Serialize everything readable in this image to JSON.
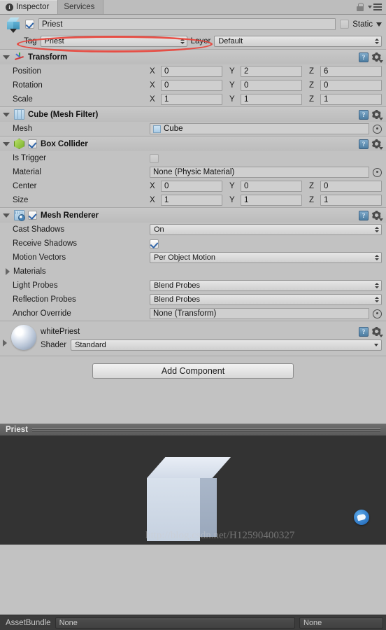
{
  "window": {
    "tabs": [
      {
        "label": "Inspector",
        "icon": "info-icon",
        "active": true
      },
      {
        "label": "Services",
        "icon": "",
        "active": false
      }
    ],
    "lock_icon": "lock-icon",
    "menu_icon": "menu-icon"
  },
  "object_header": {
    "icon": "cube-prefab-icon",
    "enabled": true,
    "name": "Priest",
    "static_label": "Static",
    "static_checked": false
  },
  "tag_layer": {
    "tag_label": "Tag",
    "tag_value": "Priest",
    "layer_label": "Layer",
    "layer_value": "Default",
    "annotation_color": "#e8433a"
  },
  "components": [
    {
      "title": "Transform",
      "icon": "transform-icon",
      "has_checkbox": false,
      "expanded": true,
      "rows": [
        {
          "label": "Position",
          "type": "vector3",
          "x": "0",
          "y": "2",
          "z": "6"
        },
        {
          "label": "Rotation",
          "type": "vector3",
          "x": "0",
          "y": "0",
          "z": "0"
        },
        {
          "label": "Scale",
          "type": "vector3",
          "x": "1",
          "y": "1",
          "z": "1"
        }
      ]
    },
    {
      "title": "Cube (Mesh Filter)",
      "icon": "mesh-filter-icon",
      "has_checkbox": false,
      "expanded": true,
      "rows": [
        {
          "label": "Mesh",
          "type": "object",
          "value": "Cube",
          "value_icon": "mesh-icon"
        }
      ]
    },
    {
      "title": "Box Collider",
      "icon": "box-collider-icon",
      "has_checkbox": true,
      "checked": true,
      "expanded": true,
      "rows": [
        {
          "label": "Is Trigger",
          "type": "checkbox",
          "checked": false
        },
        {
          "label": "Material",
          "type": "object",
          "value": "None (Physic Material)"
        },
        {
          "label": "Center",
          "type": "vector3",
          "x": "0",
          "y": "0",
          "z": "0"
        },
        {
          "label": "Size",
          "type": "vector3",
          "x": "1",
          "y": "1",
          "z": "1"
        }
      ]
    },
    {
      "title": "Mesh Renderer",
      "icon": "mesh-renderer-icon",
      "has_checkbox": true,
      "checked": true,
      "expanded": true,
      "rows": [
        {
          "label": "Cast Shadows",
          "type": "popup",
          "value": "On"
        },
        {
          "label": "Receive Shadows",
          "type": "checkbox",
          "checked": true
        },
        {
          "label": "Motion Vectors",
          "type": "popup",
          "value": "Per Object Motion"
        },
        {
          "label": "Materials",
          "type": "foldout"
        },
        {
          "label": "Light Probes",
          "type": "popup",
          "value": "Blend Probes"
        },
        {
          "label": "Reflection Probes",
          "type": "popup",
          "value": "Blend Probes"
        },
        {
          "label": "Anchor Override",
          "type": "object",
          "value": "None (Transform)"
        }
      ]
    }
  ],
  "material": {
    "name": "whitePriest",
    "shader_label": "Shader",
    "shader_value": "Standard",
    "preview_icon": "material-sphere-icon"
  },
  "add_component": {
    "label": "Add Component"
  },
  "preview": {
    "title": "Priest",
    "watermark": "http://blog.csdn.net/H12590400327",
    "badge_icon": "csdn-badge-icon",
    "background_color": "#333333"
  },
  "asset_bundle": {
    "label": "AssetBundle",
    "name_value": "None",
    "variant_value": "None"
  }
}
